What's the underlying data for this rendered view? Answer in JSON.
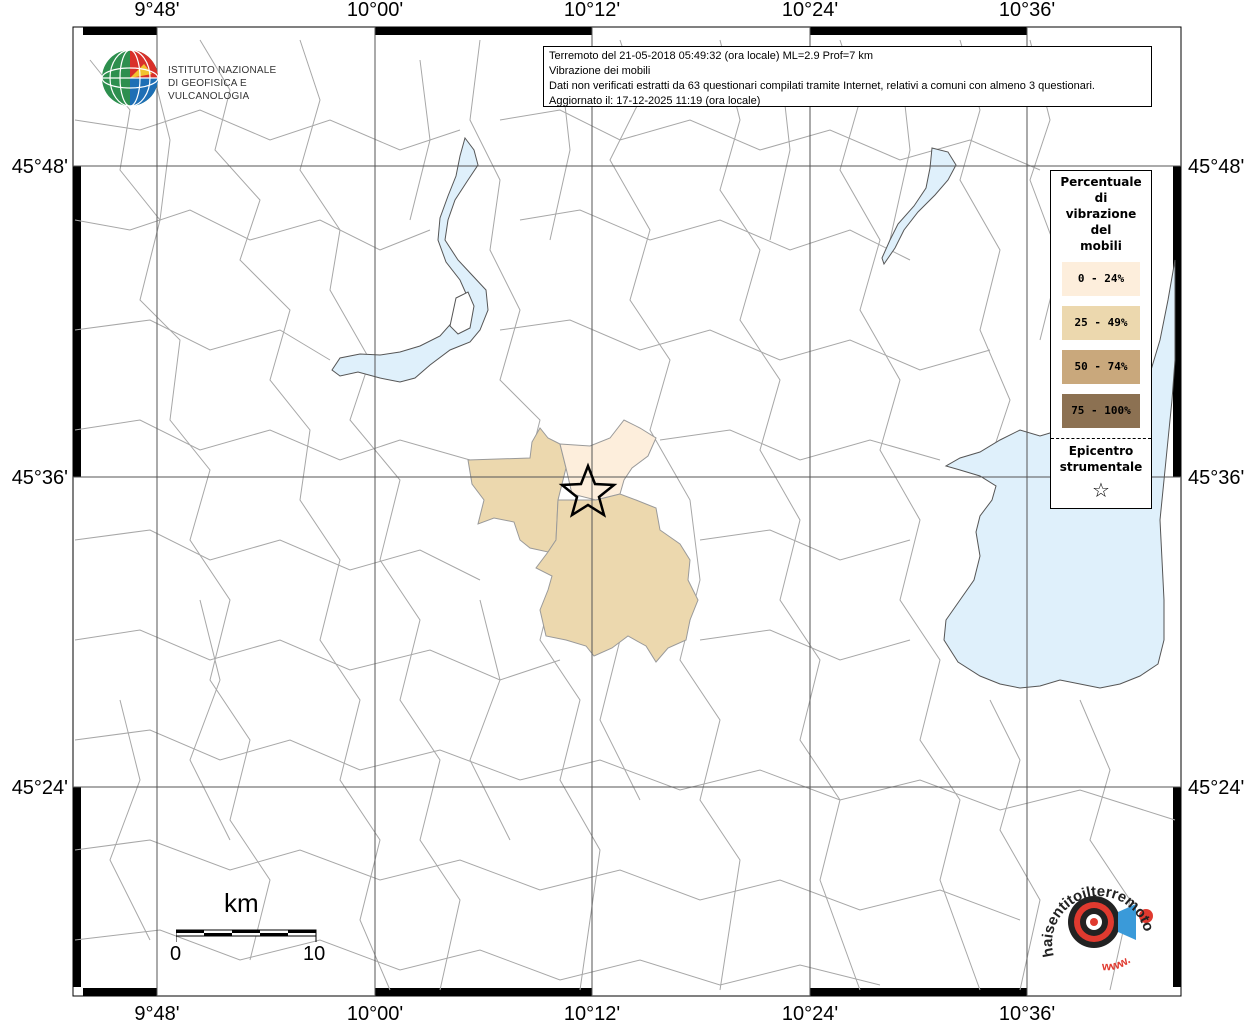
{
  "coords": {
    "lon_top": [
      "9°48'",
      "10°00'",
      "10°12'",
      "10°24'",
      "10°36'"
    ],
    "lon_bottom": [
      "9°48'",
      "10°00'",
      "10°12'",
      "10°24'",
      "10°36'"
    ],
    "lat_left": [
      "45°48'",
      "45°36'",
      "45°24'"
    ],
    "lat_right": [
      "45°48'",
      "45°36'",
      "45°24'"
    ]
  },
  "info": {
    "line1": "Terremoto del 21-05-2018 05:49:32 (ora locale) ML=2.9 Prof=7 km",
    "line2": "Vibrazione dei mobili",
    "line3": "Dati non verificati estratti da 63 questionari compilati tramite Internet, relativi a comuni con almeno 3 questionari.",
    "line4": "Aggiornato il: 17-12-2025 11:19 (ora locale)"
  },
  "logo": {
    "line1": "ISTITUTO NAZIONALE",
    "line2": "DI GEOFISICA E VULCANOLOGIA"
  },
  "legend": {
    "title_lines": [
      "Percentuale",
      "di",
      "vibrazione",
      "del",
      "mobili"
    ],
    "classes": [
      {
        "label": "0 - 24%",
        "color": "#fdeedc"
      },
      {
        "label": "25 - 49%",
        "color": "#ecd8ae"
      },
      {
        "label": "50 - 74%",
        "color": "#c9a87c"
      },
      {
        "label": "75 - 100%",
        "color": "#8c7152"
      }
    ],
    "epicenter_lines": [
      "Epicentro",
      "strumentale"
    ],
    "epicenter_symbol": "☆"
  },
  "scalebar": {
    "unit": "km",
    "min_label": "0",
    "max_label": "10"
  },
  "hsit_logo": {
    "text": "haisentitoilterremoto.it",
    "url_text": "www."
  },
  "colors": {
    "water": "#dff0fb",
    "border": "#9a9a9a",
    "lake_border": "#555555"
  }
}
